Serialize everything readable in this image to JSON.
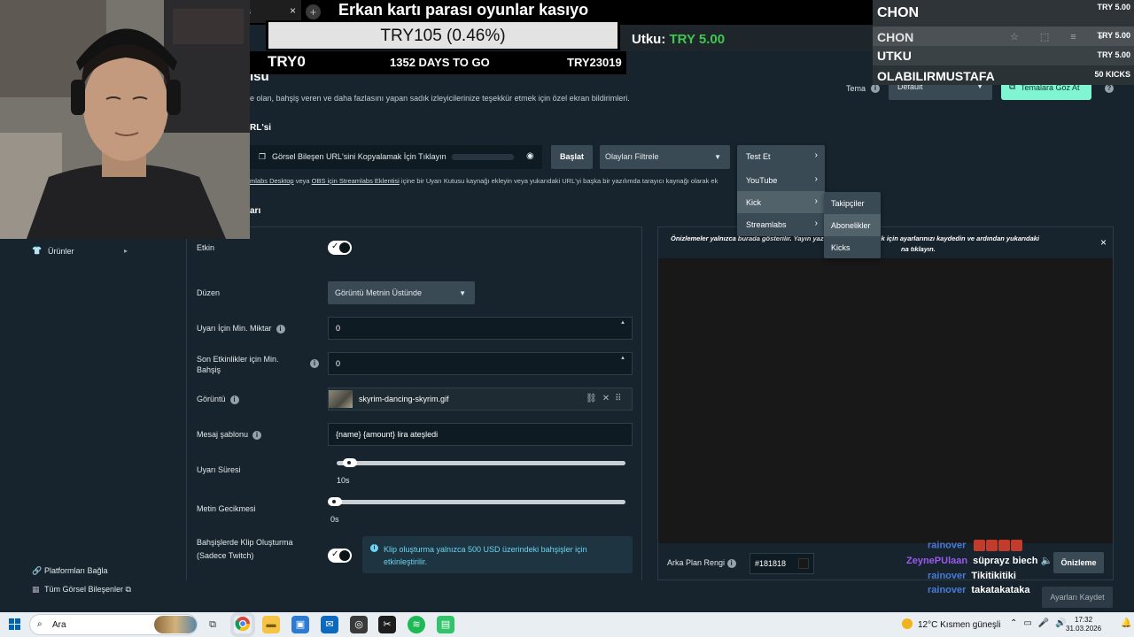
{
  "browser": {
    "tab_close": "×",
    "tab_text": "s",
    "new_tab": "+"
  },
  "overlay": {
    "goal_title": "Erkan kartı parası oyunlar kasıyo",
    "goal_progress_text": "TRY105 (0.46%)",
    "goal_progress_fraction": 0.0046,
    "goal_start": "TRY0",
    "goal_days": "1352 DAYS TO GO",
    "goal_target": "TRY23019",
    "latest_donor_name": "Utku:",
    "latest_donor_amount": "TRY 5.00",
    "top_list": [
      {
        "name": "CHON",
        "amount": "TRY 5.00"
      },
      {
        "name": "CHON",
        "amount": "TRY 5.00"
      },
      {
        "name": "UTKU",
        "amount": "TRY 5.00"
      },
      {
        "name": "OLABILIRMUSTAFA",
        "amount": "50 KICKS"
      }
    ],
    "top_list_icons": [
      "star-icon",
      "extension-icon",
      "playlist-icon",
      "profile-icon"
    ]
  },
  "page": {
    "title": "ısu",
    "description": "e olan, bahşiş veren ve daha fazlasını yapan sadık izleyicilerinize teşekkür etmek için özel ekran bildirimleri.",
    "theme_label": "Tema",
    "theme_value": "Default",
    "themes_button": "Temalara Göz At",
    "url_section": "RL'si",
    "url_copy_text": "Görsel Bileşen URL'sini Kopyalamak İçin Tıklayın",
    "start_button": "Başlat",
    "filter_events": "Olayları Filtrele",
    "hint_link1": "mlabs Desktop",
    "hint_mid": " veya ",
    "hint_link2": "OBS için Streamlabs Eklentisi",
    "hint_rest": " içine bir Uyarı Kutusu kaynağı ekleyin veya yukarıdaki URL'yi başka bir yazılımda tarayıcı kaynağı olarak ek",
    "alerts_section": "arı"
  },
  "menu_test": {
    "items": [
      {
        "label": "Test Et"
      },
      {
        "label": "YouTube"
      },
      {
        "label": "Kick"
      },
      {
        "label": "Streamlabs"
      }
    ]
  },
  "menu_kick": {
    "items": [
      {
        "label": "Takipçiler"
      },
      {
        "label": "Abonelikler"
      },
      {
        "label": "Kicks"
      }
    ]
  },
  "nav": {
    "products": "Ürünler",
    "connect_platforms": "Platformları Bağla",
    "all_widgets": "Tüm Görsel Bileşenler"
  },
  "settings": {
    "enabled_label": "Etkin",
    "enabled": true,
    "layout_label": "Düzen",
    "layout_value": "Görüntü Metnin Üstünde",
    "min_amount_label": "Uyarı İçin Min. Miktar",
    "min_amount_value": "0",
    "recent_min_label_1": "Son Etkinlikler için Min.",
    "recent_min_label_2": "Bahşiş",
    "recent_min_value": "0",
    "image_label": "Görüntü",
    "image_value": "skyrim-dancing-skyrim.gif",
    "message_label": "Mesaj şablonu",
    "message_value": "{name}  {amount} lira ateşledi",
    "duration_label": "Uyarı Süresi",
    "duration_value": "10s",
    "duration_fraction": 0.03,
    "text_delay_label": "Metin Gecikmesi",
    "text_delay_value": "0s",
    "text_delay_fraction": 0.0,
    "clip_label_1": "Bahşişlerde Klip Oluşturma",
    "clip_label_2": "(Sadece Twitch)",
    "clip_enabled": true,
    "clip_note": "Klip oluşturma yalnızca 500 USD üzerindeki bahşişler için etkinleştirilir."
  },
  "preview": {
    "note_line1": "Önizlemeler yalnızca burada gösterilir. Yayın yazılı",
    "note_line1b": "eri görüntülemek için ayarlarınızı kaydedin ve ardından yukarıdaki",
    "note_line2": "na tıklayın.",
    "close": "×",
    "bg_label": "Arka Plan Rengi",
    "bg_value": "#181818",
    "preview_button": "Önizleme",
    "save_button": "Ayarları Kaydet"
  },
  "chat": [
    {
      "user": "rainover",
      "message": "",
      "emotes": 4
    },
    {
      "user": "ZeynePUlaan",
      "message": "süprayz biech 🔈",
      "emotes": 0
    },
    {
      "user": "rainover",
      "message": "Tikitikitiki",
      "emotes": 0
    },
    {
      "user": "rainover",
      "message": "takatakataka",
      "emotes": 0
    }
  ],
  "taskbar": {
    "search_placeholder": "Ara",
    "weather": "12°C  Kısmen güneşli",
    "time": "17:32",
    "date": "31.03.2026"
  },
  "colors": {
    "page_bg": "#17242d",
    "accent_mint": "#80f5d2",
    "menu_bg": "#3a4a54",
    "donor_green": "#3ec84f",
    "info_blue": "#6ad4f2"
  }
}
